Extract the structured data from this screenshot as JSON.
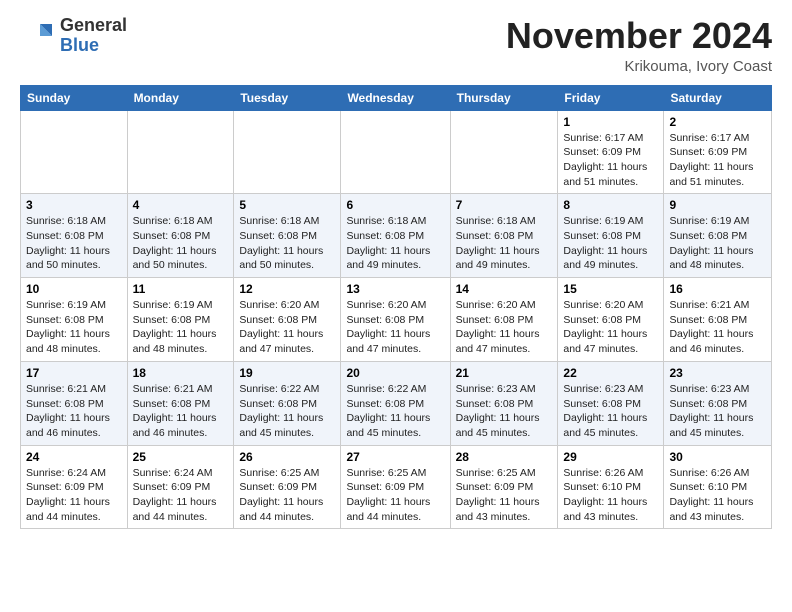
{
  "header": {
    "logo_general": "General",
    "logo_blue": "Blue",
    "month_title": "November 2024",
    "location": "Krikouma, Ivory Coast"
  },
  "weekdays": [
    "Sunday",
    "Monday",
    "Tuesday",
    "Wednesday",
    "Thursday",
    "Friday",
    "Saturday"
  ],
  "weeks": [
    [
      {
        "day": "",
        "info": ""
      },
      {
        "day": "",
        "info": ""
      },
      {
        "day": "",
        "info": ""
      },
      {
        "day": "",
        "info": ""
      },
      {
        "day": "",
        "info": ""
      },
      {
        "day": "1",
        "info": "Sunrise: 6:17 AM\nSunset: 6:09 PM\nDaylight: 11 hours\nand 51 minutes."
      },
      {
        "day": "2",
        "info": "Sunrise: 6:17 AM\nSunset: 6:09 PM\nDaylight: 11 hours\nand 51 minutes."
      }
    ],
    [
      {
        "day": "3",
        "info": "Sunrise: 6:18 AM\nSunset: 6:08 PM\nDaylight: 11 hours\nand 50 minutes."
      },
      {
        "day": "4",
        "info": "Sunrise: 6:18 AM\nSunset: 6:08 PM\nDaylight: 11 hours\nand 50 minutes."
      },
      {
        "day": "5",
        "info": "Sunrise: 6:18 AM\nSunset: 6:08 PM\nDaylight: 11 hours\nand 50 minutes."
      },
      {
        "day": "6",
        "info": "Sunrise: 6:18 AM\nSunset: 6:08 PM\nDaylight: 11 hours\nand 49 minutes."
      },
      {
        "day": "7",
        "info": "Sunrise: 6:18 AM\nSunset: 6:08 PM\nDaylight: 11 hours\nand 49 minutes."
      },
      {
        "day": "8",
        "info": "Sunrise: 6:19 AM\nSunset: 6:08 PM\nDaylight: 11 hours\nand 49 minutes."
      },
      {
        "day": "9",
        "info": "Sunrise: 6:19 AM\nSunset: 6:08 PM\nDaylight: 11 hours\nand 48 minutes."
      }
    ],
    [
      {
        "day": "10",
        "info": "Sunrise: 6:19 AM\nSunset: 6:08 PM\nDaylight: 11 hours\nand 48 minutes."
      },
      {
        "day": "11",
        "info": "Sunrise: 6:19 AM\nSunset: 6:08 PM\nDaylight: 11 hours\nand 48 minutes."
      },
      {
        "day": "12",
        "info": "Sunrise: 6:20 AM\nSunset: 6:08 PM\nDaylight: 11 hours\nand 47 minutes."
      },
      {
        "day": "13",
        "info": "Sunrise: 6:20 AM\nSunset: 6:08 PM\nDaylight: 11 hours\nand 47 minutes."
      },
      {
        "day": "14",
        "info": "Sunrise: 6:20 AM\nSunset: 6:08 PM\nDaylight: 11 hours\nand 47 minutes."
      },
      {
        "day": "15",
        "info": "Sunrise: 6:20 AM\nSunset: 6:08 PM\nDaylight: 11 hours\nand 47 minutes."
      },
      {
        "day": "16",
        "info": "Sunrise: 6:21 AM\nSunset: 6:08 PM\nDaylight: 11 hours\nand 46 minutes."
      }
    ],
    [
      {
        "day": "17",
        "info": "Sunrise: 6:21 AM\nSunset: 6:08 PM\nDaylight: 11 hours\nand 46 minutes."
      },
      {
        "day": "18",
        "info": "Sunrise: 6:21 AM\nSunset: 6:08 PM\nDaylight: 11 hours\nand 46 minutes."
      },
      {
        "day": "19",
        "info": "Sunrise: 6:22 AM\nSunset: 6:08 PM\nDaylight: 11 hours\nand 45 minutes."
      },
      {
        "day": "20",
        "info": "Sunrise: 6:22 AM\nSunset: 6:08 PM\nDaylight: 11 hours\nand 45 minutes."
      },
      {
        "day": "21",
        "info": "Sunrise: 6:23 AM\nSunset: 6:08 PM\nDaylight: 11 hours\nand 45 minutes."
      },
      {
        "day": "22",
        "info": "Sunrise: 6:23 AM\nSunset: 6:08 PM\nDaylight: 11 hours\nand 45 minutes."
      },
      {
        "day": "23",
        "info": "Sunrise: 6:23 AM\nSunset: 6:08 PM\nDaylight: 11 hours\nand 45 minutes."
      }
    ],
    [
      {
        "day": "24",
        "info": "Sunrise: 6:24 AM\nSunset: 6:09 PM\nDaylight: 11 hours\nand 44 minutes."
      },
      {
        "day": "25",
        "info": "Sunrise: 6:24 AM\nSunset: 6:09 PM\nDaylight: 11 hours\nand 44 minutes."
      },
      {
        "day": "26",
        "info": "Sunrise: 6:25 AM\nSunset: 6:09 PM\nDaylight: 11 hours\nand 44 minutes."
      },
      {
        "day": "27",
        "info": "Sunrise: 6:25 AM\nSunset: 6:09 PM\nDaylight: 11 hours\nand 44 minutes."
      },
      {
        "day": "28",
        "info": "Sunrise: 6:25 AM\nSunset: 6:09 PM\nDaylight: 11 hours\nand 43 minutes."
      },
      {
        "day": "29",
        "info": "Sunrise: 6:26 AM\nSunset: 6:10 PM\nDaylight: 11 hours\nand 43 minutes."
      },
      {
        "day": "30",
        "info": "Sunrise: 6:26 AM\nSunset: 6:10 PM\nDaylight: 11 hours\nand 43 minutes."
      }
    ]
  ]
}
